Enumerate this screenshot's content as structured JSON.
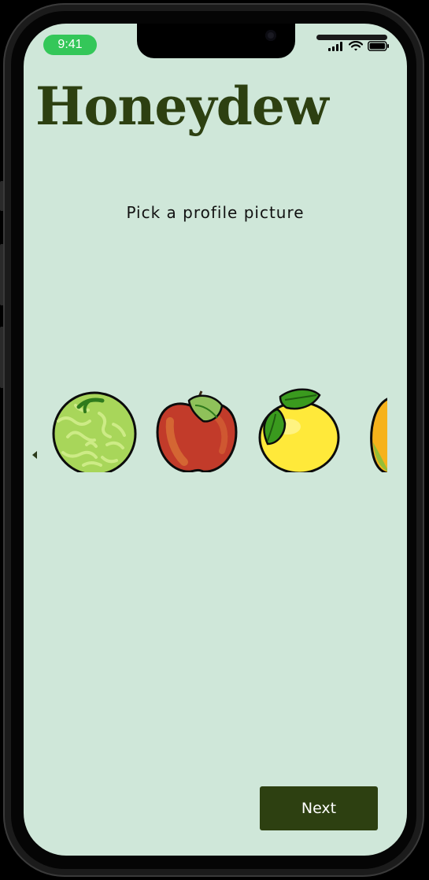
{
  "status_bar": {
    "time": "9:41",
    "icons": [
      "signal-icon",
      "wifi-icon",
      "battery-icon"
    ]
  },
  "app": {
    "title": "Honeydew"
  },
  "screen": {
    "subtitle": "Pick a profile picture"
  },
  "avatars": [
    {
      "name": "honeydew-melon-avatar"
    },
    {
      "name": "apple-avatar"
    },
    {
      "name": "lemon-avatar"
    },
    {
      "name": "mango-avatar"
    }
  ],
  "carousel": {
    "prev_icon": "caret-left-icon"
  },
  "actions": {
    "next_label": "Next"
  },
  "colors": {
    "background": "#cfe7d9",
    "brand": "#2d4011",
    "time_pill": "#34c759"
  }
}
